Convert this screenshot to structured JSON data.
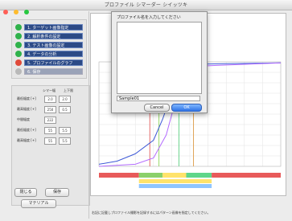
{
  "window": {
    "title": "プロファイル シマーダー シイッツキ"
  },
  "steps": [
    {
      "label": "1. ターゲット画像指定",
      "dot": "#2fb24b",
      "enabled": true
    },
    {
      "label": "2. 解析条件の設定",
      "dot": "#2fb24b",
      "enabled": true
    },
    {
      "label": "3. テスト画像の設定",
      "dot": "#2fb24b",
      "enabled": true
    },
    {
      "label": "4. データの分析",
      "dot": "#2fb24b",
      "enabled": true
    },
    {
      "label": "5. プロファイルのグラフ",
      "dot": "#e04a3a",
      "enabled": true
    },
    {
      "label": "6. 保存",
      "dot": "#b9b9b9",
      "enabled": false
    }
  ],
  "params": {
    "headers": [
      "シマー幅",
      "上下限"
    ],
    "rows": [
      {
        "label": "最低幅度 [+]",
        "a": "2.0",
        "b": "2.0"
      },
      {
        "label": "最高幅度 [+]",
        "a": "250",
        "b": "0.5"
      },
      {
        "label": "中間幅度",
        "a": "222",
        "b": ""
      },
      {
        "label": "最低幅度 [+]",
        "a": "55",
        "b": "5.5"
      },
      {
        "label": "最高幅度 [+]",
        "a": "55",
        "b": "5.5"
      }
    ]
  },
  "buttons": {
    "close": "閉じる",
    "save": "保存",
    "export": "マテリアル"
  },
  "dialog": {
    "title": "プロファイル名を入力してください",
    "input_value": "Sample01",
    "cancel": "Cancel",
    "ok": "OK"
  },
  "chart_data": {
    "type": "line",
    "xlabel": "",
    "ylabel": "",
    "series": [
      {
        "color": "#3d59d6",
        "points": [
          [
            0,
            0.02
          ],
          [
            0.1,
            0.05
          ],
          [
            0.2,
            0.12
          ],
          [
            0.3,
            0.25
          ],
          [
            0.35,
            0.45
          ],
          [
            0.4,
            0.7
          ],
          [
            0.45,
            0.88
          ],
          [
            0.5,
            0.95
          ],
          [
            0.6,
            0.98
          ],
          [
            1.0,
            0.99
          ]
        ]
      },
      {
        "color": "#b36cff",
        "points": [
          [
            0,
            0.0
          ],
          [
            0.2,
            0.02
          ],
          [
            0.3,
            0.08
          ],
          [
            0.37,
            0.3
          ],
          [
            0.42,
            0.62
          ],
          [
            0.48,
            0.86
          ],
          [
            0.55,
            0.96
          ],
          [
            1.0,
            0.99
          ]
        ]
      }
    ],
    "vlines": [
      {
        "x": 0.28,
        "color": "#e46a6a"
      },
      {
        "x": 0.33,
        "color": "#9ad96b"
      },
      {
        "x": 0.44,
        "color": "#6ad38d"
      },
      {
        "x": 0.52,
        "color": "#e0a458"
      }
    ],
    "bands": [
      {
        "x0": 0.0,
        "x1": 0.22,
        "color": "#e85a5a"
      },
      {
        "x0": 0.22,
        "x1": 0.35,
        "color": "#8bd06a"
      },
      {
        "x0": 0.35,
        "x1": 0.48,
        "color": "#ffe36b"
      },
      {
        "x0": 0.48,
        "x1": 0.62,
        "color": "#5fd68a"
      },
      {
        "x0": 0.62,
        "x1": 1.0,
        "color": "#e85a5a"
      }
    ]
  },
  "note": "右記に記載しプロファイル撮影を記録するにはパターン画像を指定してください。"
}
